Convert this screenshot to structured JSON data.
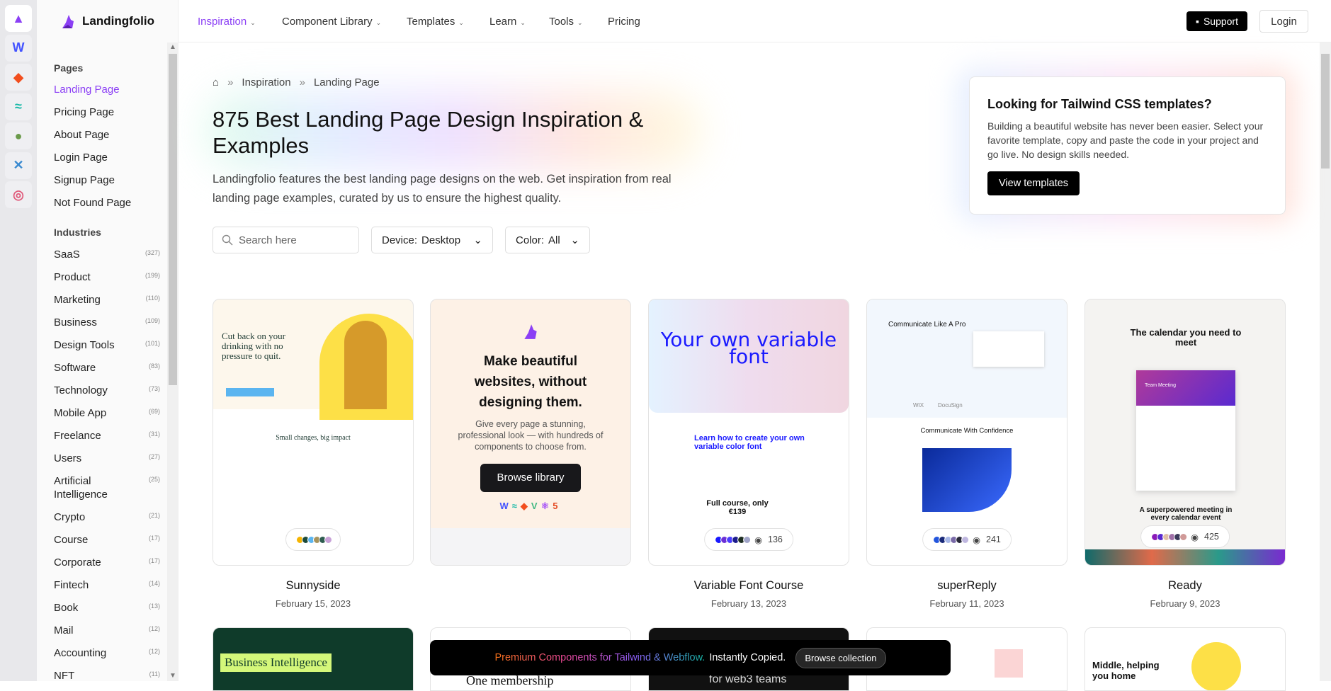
{
  "brand": {
    "name": "Landingfolio",
    "accent": "#8b3ff5"
  },
  "rail": [
    {
      "icon": "landingfolio-icon"
    },
    {
      "icon": "webflow-icon"
    },
    {
      "icon": "figma-icon"
    },
    {
      "icon": "tailwind-icon"
    },
    {
      "icon": "leaf-icon"
    },
    {
      "icon": "x-app-icon"
    },
    {
      "icon": "camera-app-icon"
    }
  ],
  "nav": {
    "items": [
      {
        "label": "Inspiration",
        "active": true
      },
      {
        "label": "Component Library"
      },
      {
        "label": "Templates"
      },
      {
        "label": "Learn"
      },
      {
        "label": "Tools"
      },
      {
        "label": "Pricing"
      }
    ],
    "support": "Support",
    "login": "Login"
  },
  "sidebar": {
    "pages_heading": "Pages",
    "pages": [
      "Landing Page",
      "Pricing Page",
      "About Page",
      "Login Page",
      "Signup Page",
      "Not Found Page"
    ],
    "industries_heading": "Industries",
    "industries": [
      {
        "label": "SaaS",
        "count": "(327)"
      },
      {
        "label": "Product",
        "count": "(199)"
      },
      {
        "label": "Marketing",
        "count": "(110)"
      },
      {
        "label": "Business",
        "count": "(109)"
      },
      {
        "label": "Design Tools",
        "count": "(101)"
      },
      {
        "label": "Software",
        "count": "(83)"
      },
      {
        "label": "Technology",
        "count": "(73)"
      },
      {
        "label": "Mobile App",
        "count": "(69)"
      },
      {
        "label": "Freelance",
        "count": "(31)"
      },
      {
        "label": "Users",
        "count": "(27)"
      },
      {
        "label": "Artificial Intelligence",
        "count": "(25)"
      },
      {
        "label": "Crypto",
        "count": "(21)"
      },
      {
        "label": "Course",
        "count": "(17)"
      },
      {
        "label": "Corporate",
        "count": "(17)"
      },
      {
        "label": "Fintech",
        "count": "(14)"
      },
      {
        "label": "Book",
        "count": "(13)"
      },
      {
        "label": "Mail",
        "count": "(12)"
      },
      {
        "label": "Accounting",
        "count": "(12)"
      },
      {
        "label": "NFT",
        "count": "(11)"
      }
    ]
  },
  "breadcrumb": [
    "Inspiration",
    "Landing Page"
  ],
  "hero": {
    "title": "875 Best Landing Page Design Inspiration & Examples",
    "description": "Landingfolio features the best landing page designs on the web. Get inspiration from real landing page examples, curated by us to ensure the highest quality."
  },
  "filters": {
    "search_placeholder": "Search here",
    "device_label": "Device:",
    "device_value": "Desktop",
    "color_label": "Color:",
    "color_value": "All"
  },
  "promo": {
    "title": "Looking for Tailwind CSS templates?",
    "text": "Building a beautiful website has never been easier. Select your favorite template, copy and paste the code in your project and go live. No design skills needed.",
    "button": "View templates"
  },
  "library_card": {
    "title": "Make beautiful websites, without designing them.",
    "text": "Give every page a stunning, professional look — with hundreds of components to choose from.",
    "button": "Browse library"
  },
  "cards": [
    {
      "title": "Sunnyside",
      "date": "February 15, 2023",
      "views": "",
      "colors": [
        "#f5b400",
        "#1d4a3a",
        "#5bb5f0",
        "#a7935c",
        "#2f5d50",
        "#c8a2d8"
      ],
      "preview": {
        "headline": "Cut back on your drinking with no pressure to quit.",
        "section": "Small changes, big impact"
      }
    },
    {
      "title": "Variable Font Course",
      "date": "February 13, 2023",
      "views": "136",
      "colors": [
        "#1a1aff",
        "#6b2fd6",
        "#4a3cff",
        "#1c1c8c",
        "#1e2e22",
        "#a0a4c8"
      ],
      "preview": {
        "headline": "Your own variable font",
        "section": "Learn how to create your own variable color font",
        "price": "Full course, only €139"
      }
    },
    {
      "title": "superReply",
      "date": "February 11, 2023",
      "views": "241",
      "colors": [
        "#2255dd",
        "#1a2a7a",
        "#a8b8e8",
        "#7a6aa8",
        "#2a2a3a",
        "#c0b8e0"
      ],
      "preview": {
        "headline": "Communicate Like A Pro",
        "section": "Communicate With Confidence",
        "logos": [
          "WIX",
          "DocuSign"
        ]
      }
    },
    {
      "title": "Ready",
      "date": "February 9, 2023",
      "views": "425",
      "colors": [
        "#8a1ab8",
        "#5a2ad0",
        "#e0c0a8",
        "#a070a8",
        "#3a3a5a",
        "#d09a98"
      ],
      "preview": {
        "headline": "The calendar you need to meet",
        "section": "A superpowered meeting in every calendar event",
        "window": "Team Meeting"
      }
    }
  ],
  "row2": [
    {
      "text": "Business Intelligence"
    },
    {
      "text": "One membership"
    },
    {
      "text": "for web3 teams"
    },
    {
      "text": ""
    },
    {
      "text": "Middle, helping you home"
    }
  ],
  "banner": {
    "text": "Premium Components for Tailwind & Webflow.",
    "strong": "Instantly Copied.",
    "button": "Browse collection"
  }
}
